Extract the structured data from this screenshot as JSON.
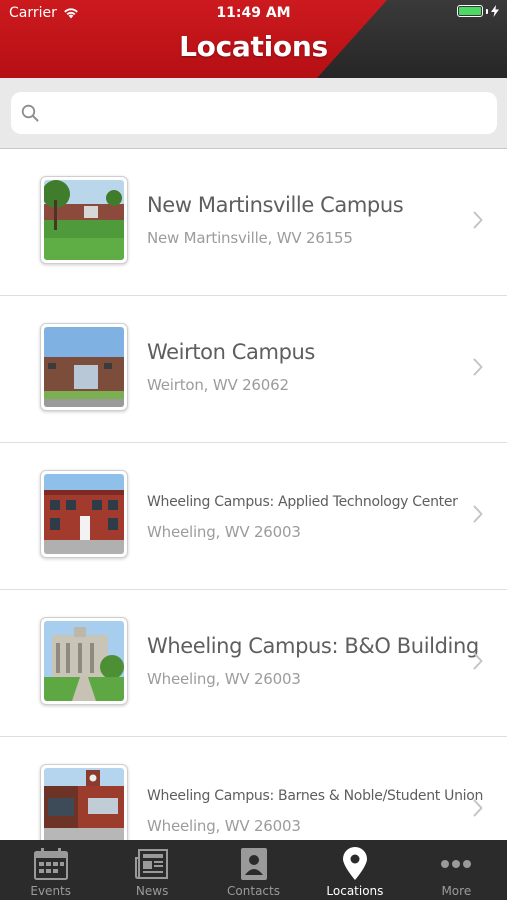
{
  "status_bar": {
    "carrier": "Carrier",
    "time": "11:49 AM"
  },
  "header": {
    "title": "Locations"
  },
  "search": {
    "placeholder": "",
    "value": ""
  },
  "locations": [
    {
      "title": "New Martinsville Campus",
      "address": "New Martinsville, WV 26155",
      "image": "campus-lawn-photo"
    },
    {
      "title": "Weirton Campus",
      "address": "Weirton, WV 26062",
      "image": "campus-building-photo"
    },
    {
      "title": "Wheeling Campus: Applied Technology Center",
      "address": "Wheeling, WV 26003",
      "image": "brick-building-photo"
    },
    {
      "title": "Wheeling Campus: B&O Building",
      "address": "Wheeling, WV 26003",
      "image": "historic-building-photo"
    },
    {
      "title": "Wheeling Campus: Barnes & Noble/Student Union",
      "address": "Wheeling, WV 26003",
      "image": "bookstore-building-photo"
    }
  ],
  "tabs": [
    {
      "label": "Events",
      "icon": "calendar-icon",
      "active": false
    },
    {
      "label": "News",
      "icon": "newspaper-icon",
      "active": false
    },
    {
      "label": "Contacts",
      "icon": "contact-card-icon",
      "active": false
    },
    {
      "label": "Locations",
      "icon": "map-pin-icon",
      "active": true
    },
    {
      "label": "More",
      "icon": "more-dots-icon",
      "active": false
    }
  ],
  "colors": {
    "header_red": "#c8161c",
    "header_dark": "#2e2e2e",
    "tabbar": "#2b2b2b",
    "battery_green": "#4cd964"
  }
}
